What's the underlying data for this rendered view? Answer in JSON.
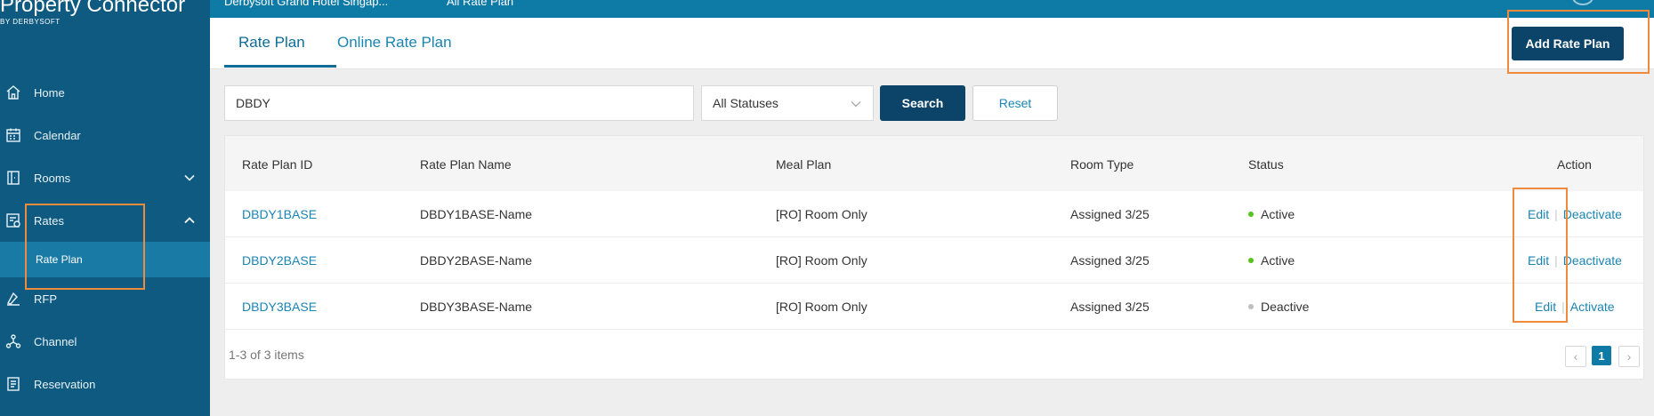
{
  "brand": {
    "title": "Property Connector",
    "subtitle": "BY DERBYSOFT"
  },
  "topbar": {
    "crumb_hotel": "Derbysoft Grand Hotel Singap...",
    "crumb_page": "All Rate Plan"
  },
  "sidebar": {
    "items": [
      {
        "label": "Home",
        "icon": "home-icon"
      },
      {
        "label": "Calendar",
        "icon": "calendar-icon"
      },
      {
        "label": "Rooms",
        "icon": "rooms-icon",
        "chevron": "down"
      },
      {
        "label": "Rates",
        "icon": "rates-icon",
        "chevron": "up"
      },
      {
        "label": "RFP",
        "icon": "rfp-icon"
      },
      {
        "label": "Channel",
        "icon": "channel-icon"
      },
      {
        "label": "Reservation",
        "icon": "reservation-icon"
      }
    ],
    "sub_item": {
      "label": "Rate Plan"
    }
  },
  "tabs": {
    "active": "Rate Plan",
    "inactive": "Online Rate Plan"
  },
  "toolbar": {
    "add_label": "Add Rate Plan"
  },
  "filters": {
    "search_value": "DBDY",
    "status_value": "All Statuses",
    "search_label": "Search",
    "reset_label": "Reset"
  },
  "table": {
    "headers": [
      "Rate Plan ID",
      "Rate Plan Name",
      "Meal Plan",
      "Room Type",
      "Status",
      "Action"
    ],
    "rows": [
      {
        "id": "DBDY1BASE",
        "name": "DBDY1BASE-Name",
        "meal": "[RO] Room Only",
        "room": "Assigned 3/25",
        "status": "Active",
        "status_color": "#52c41a",
        "edit": "Edit",
        "toggle": "Deactivate"
      },
      {
        "id": "DBDY2BASE",
        "name": "DBDY2BASE-Name",
        "meal": "[RO] Room Only",
        "room": "Assigned 3/25",
        "status": "Active",
        "status_color": "#52c41a",
        "edit": "Edit",
        "toggle": "Deactivate"
      },
      {
        "id": "DBDY3BASE",
        "name": "DBDY3BASE-Name",
        "meal": "[RO] Room Only",
        "room": "Assigned 3/25",
        "status": "Deactive",
        "status_color": "#bfbfbf",
        "edit": "Edit",
        "toggle": "Activate"
      }
    ],
    "separator": "|"
  },
  "pagination": {
    "summary": "1-3 of 3 items",
    "current": "1",
    "prev": "‹",
    "next": "›"
  },
  "colors": {
    "sidebar": "#0e5a80",
    "accent": "#0e7aa6",
    "primary_button": "#0b4468",
    "highlight": "#f08a3c"
  }
}
